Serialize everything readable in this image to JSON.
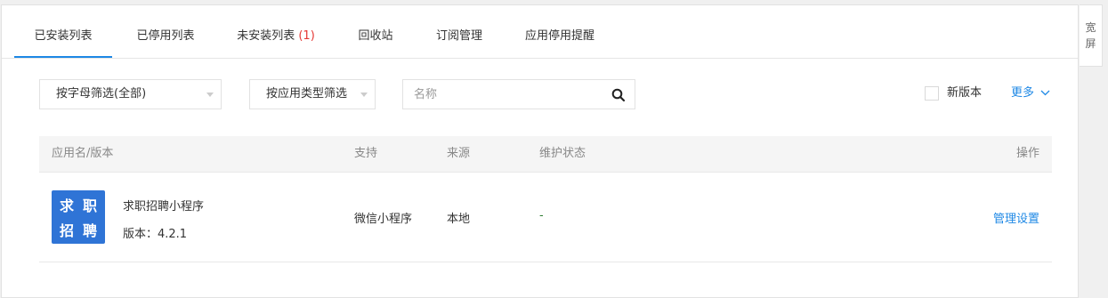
{
  "tabs": [
    {
      "label": "已安装列表",
      "active": true
    },
    {
      "label": "已停用列表"
    },
    {
      "label": "未安装列表",
      "count": "(1)"
    },
    {
      "label": "回收站"
    },
    {
      "label": "订阅管理"
    },
    {
      "label": "应用停用提醒"
    }
  ],
  "wide_mode": {
    "line1": "宽",
    "line2": "屏"
  },
  "filters": {
    "letter_filter": "按字母筛选(全部)",
    "type_filter": "按应用类型筛选",
    "search_placeholder": "名称",
    "new_version_label": "新版本",
    "more_label": "更多"
  },
  "table": {
    "headers": {
      "name": "应用名/版本",
      "support": "支持",
      "source": "来源",
      "status": "维护状态",
      "action": "操作"
    },
    "rows": [
      {
        "logo_chars": [
          "求",
          "职",
          "招",
          "聘"
        ],
        "name": "求职招聘小程序",
        "version": "版本：4.2.1",
        "support": "微信小程序",
        "source": "本地",
        "status": "-",
        "action": "管理设置"
      }
    ]
  },
  "colors": {
    "accent": "#1e88e5",
    "count": "#e53935",
    "logo_bg": "#2f74d6"
  }
}
